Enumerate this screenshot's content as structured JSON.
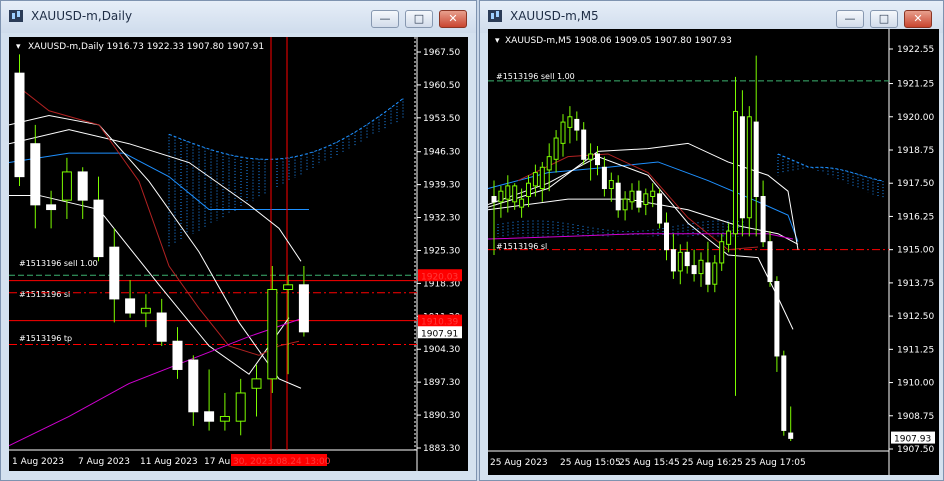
{
  "colors": {
    "background": "#000000",
    "bull_outline": "#7cfc00",
    "candle_body": "#ffffff",
    "ma_white": "#ffffff",
    "ma_red": "#b22222",
    "ma_magenta": "#d000d0",
    "ichimoku_blue": "#1e90ff",
    "order_line": "#ff0000",
    "order_green": "#3cb371"
  },
  "window_left": {
    "title": "XAUUSD-m,Daily",
    "ohlc_label": "XAUUSD-m,Daily 1916.73 1922.33 1907.80 1907.91",
    "orders": [
      "#1513196 sell 1.00",
      "#1513196 sl",
      "#1513196 tp"
    ],
    "axis_right": {
      "ticks": [
        "1967.50",
        "1960.50",
        "1953.50",
        "1946.30",
        "1939.30",
        "1932.30",
        "1925.30",
        "1918.30",
        "1911.30",
        "1904.30",
        "1897.30",
        "1890.30",
        "1883.30"
      ],
      "tags": [
        {
          "text": "1920.03",
          "bg": "#ff0000",
          "fg": "#ff3a3a"
        },
        {
          "text": "1910.39",
          "bg": "#ff0000",
          "fg": "#ff3a3a"
        },
        {
          "text": "1907.91",
          "bg": "#ffffff",
          "fg": "#000000"
        }
      ]
    },
    "axis_bottom": {
      "ticks": [
        "1 Aug 2023",
        "7 Aug 2023",
        "11 Aug 2023",
        "17 Au"
      ],
      "highlight": "30, 2023.08.24 13:00"
    }
  },
  "window_right": {
    "title": "XAUUSD-m,M5",
    "ohlc_label": "XAUUSD-m,M5 1908.06 1909.05 1907.80 1907.93",
    "orders": [
      "#1513196 sell 1.00",
      "#1513196 sl"
    ],
    "axis_right": {
      "ticks": [
        "1922.55",
        "1921.25",
        "1920.00",
        "1918.75",
        "1917.50",
        "1916.25",
        "1915.00",
        "1913.75",
        "1912.50",
        "1911.25",
        "1910.00",
        "1908.75",
        "1907.50"
      ],
      "price_tag": "1907.93"
    },
    "axis_bottom": {
      "ticks": [
        "25 Aug 2023",
        "25 Aug 15:05",
        "25 Aug 15:45",
        "25 Aug 16:25",
        "25 Aug 17:05"
      ]
    }
  },
  "chart_data": [
    {
      "type": "candlestick",
      "title": "XAUUSD-m,Daily",
      "x_labels": [
        "1 Aug 2023",
        "7 Aug 2023",
        "11 Aug 2023",
        "17 Au"
      ],
      "ylim": [
        1883.3,
        1967.5
      ],
      "candles": [
        {
          "o": 1963,
          "h": 1967,
          "l": 1939,
          "c": 1941
        },
        {
          "o": 1948,
          "h": 1952,
          "l": 1930,
          "c": 1935
        },
        {
          "o": 1935,
          "h": 1938,
          "l": 1930,
          "c": 1934
        },
        {
          "o": 1936,
          "h": 1945,
          "l": 1932,
          "c": 1942
        },
        {
          "o": 1942,
          "h": 1943,
          "l": 1932,
          "c": 1936
        },
        {
          "o": 1936,
          "h": 1941,
          "l": 1923,
          "c": 1924
        },
        {
          "o": 1926,
          "h": 1930,
          "l": 1910,
          "c": 1915
        },
        {
          "o": 1915,
          "h": 1919,
          "l": 1911,
          "c": 1912
        },
        {
          "o": 1912,
          "h": 1916,
          "l": 1909,
          "c": 1913
        },
        {
          "o": 1912,
          "h": 1915,
          "l": 1905,
          "c": 1906
        },
        {
          "o": 1906,
          "h": 1909,
          "l": 1898,
          "c": 1900
        },
        {
          "o": 1902,
          "h": 1903,
          "l": 1888,
          "c": 1891
        },
        {
          "o": 1891,
          "h": 1900,
          "l": 1887,
          "c": 1889
        },
        {
          "o": 1889,
          "h": 1895,
          "l": 1887,
          "c": 1890
        },
        {
          "o": 1889,
          "h": 1898,
          "l": 1886,
          "c": 1895
        },
        {
          "o": 1896,
          "h": 1901,
          "l": 1890,
          "c": 1898
        },
        {
          "o": 1898,
          "h": 1922,
          "l": 1895,
          "c": 1917
        },
        {
          "o": 1917,
          "h": 1920,
          "l": 1899,
          "c": 1918
        },
        {
          "o": 1918,
          "h": 1922,
          "l": 1907,
          "c": 1908
        }
      ]
    },
    {
      "type": "candlestick",
      "title": "XAUUSD-m,M5",
      "x_labels": [
        "25 Aug 2023",
        "25 Aug 15:05",
        "25 Aug 15:45",
        "25 Aug 16:25",
        "25 Aug 17:05"
      ],
      "ylim": [
        1907.5,
        1922.55
      ],
      "candles": [
        {
          "o": 1917.0,
          "h": 1917.6,
          "l": 1914.8,
          "c": 1916.8
        },
        {
          "o": 1916.8,
          "h": 1917.4,
          "l": 1916.2,
          "c": 1917.2
        },
        {
          "o": 1916.9,
          "h": 1917.8,
          "l": 1916.4,
          "c": 1917.4
        },
        {
          "o": 1916.8,
          "h": 1917.5,
          "l": 1916.5,
          "c": 1917.4
        },
        {
          "o": 1916.6,
          "h": 1917.3,
          "l": 1916.2,
          "c": 1916.9
        },
        {
          "o": 1917.0,
          "h": 1917.8,
          "l": 1916.6,
          "c": 1917.5
        },
        {
          "o": 1917.4,
          "h": 1918.2,
          "l": 1917.0,
          "c": 1917.9
        },
        {
          "o": 1917.3,
          "h": 1918.3,
          "l": 1916.8,
          "c": 1918.1
        },
        {
          "o": 1918.0,
          "h": 1919.0,
          "l": 1917.2,
          "c": 1918.5
        },
        {
          "o": 1918.4,
          "h": 1919.5,
          "l": 1917.9,
          "c": 1919.2
        },
        {
          "o": 1919.0,
          "h": 1920.1,
          "l": 1918.5,
          "c": 1919.8
        },
        {
          "o": 1919.6,
          "h": 1920.4,
          "l": 1919.0,
          "c": 1920.0
        },
        {
          "o": 1919.9,
          "h": 1920.2,
          "l": 1919.1,
          "c": 1919.5
        },
        {
          "o": 1919.5,
          "h": 1919.8,
          "l": 1918.2,
          "c": 1918.4
        },
        {
          "o": 1918.4,
          "h": 1919.0,
          "l": 1917.6,
          "c": 1918.6
        },
        {
          "o": 1918.6,
          "h": 1918.9,
          "l": 1917.8,
          "c": 1918.2
        },
        {
          "o": 1918.1,
          "h": 1918.5,
          "l": 1917.0,
          "c": 1917.3
        },
        {
          "o": 1917.3,
          "h": 1917.9,
          "l": 1916.8,
          "c": 1917.6
        },
        {
          "o": 1917.5,
          "h": 1917.8,
          "l": 1916.2,
          "c": 1916.5
        },
        {
          "o": 1916.5,
          "h": 1917.2,
          "l": 1916.1,
          "c": 1916.9
        },
        {
          "o": 1916.8,
          "h": 1917.5,
          "l": 1916.5,
          "c": 1917.2
        },
        {
          "o": 1917.2,
          "h": 1917.6,
          "l": 1916.4,
          "c": 1916.6
        },
        {
          "o": 1916.7,
          "h": 1917.3,
          "l": 1916.3,
          "c": 1917.1
        },
        {
          "o": 1917.0,
          "h": 1917.5,
          "l": 1916.6,
          "c": 1917.2
        },
        {
          "o": 1917.1,
          "h": 1917.3,
          "l": 1915.8,
          "c": 1916.0
        },
        {
          "o": 1916.0,
          "h": 1916.4,
          "l": 1914.6,
          "c": 1915.0
        },
        {
          "o": 1915.0,
          "h": 1915.6,
          "l": 1913.9,
          "c": 1914.2
        },
        {
          "o": 1914.2,
          "h": 1915.2,
          "l": 1913.7,
          "c": 1914.9
        },
        {
          "o": 1914.9,
          "h": 1915.3,
          "l": 1914.1,
          "c": 1914.4
        },
        {
          "o": 1914.4,
          "h": 1915.0,
          "l": 1913.8,
          "c": 1914.1
        },
        {
          "o": 1914.1,
          "h": 1914.9,
          "l": 1913.6,
          "c": 1914.6
        },
        {
          "o": 1914.5,
          "h": 1915.3,
          "l": 1913.4,
          "c": 1913.7
        },
        {
          "o": 1913.7,
          "h": 1914.8,
          "l": 1913.4,
          "c": 1914.5
        },
        {
          "o": 1914.5,
          "h": 1915.6,
          "l": 1914.2,
          "c": 1915.3
        },
        {
          "o": 1915.2,
          "h": 1916.0,
          "l": 1914.9,
          "c": 1915.7
        },
        {
          "o": 1915.6,
          "h": 1921.5,
          "l": 1909.5,
          "c": 1920.2
        },
        {
          "o": 1920.0,
          "h": 1921.0,
          "l": 1915.5,
          "c": 1916.2
        },
        {
          "o": 1916.2,
          "h": 1920.4,
          "l": 1915.5,
          "c": 1920.0
        },
        {
          "o": 1919.8,
          "h": 1922.3,
          "l": 1915.5,
          "c": 1917.0
        },
        {
          "o": 1917.0,
          "h": 1917.6,
          "l": 1915.1,
          "c": 1915.3
        },
        {
          "o": 1915.3,
          "h": 1915.7,
          "l": 1913.6,
          "c": 1913.8
        },
        {
          "o": 1913.8,
          "h": 1914.0,
          "l": 1910.4,
          "c": 1911.0
        },
        {
          "o": 1911.0,
          "h": 1911.2,
          "l": 1908.0,
          "c": 1908.2
        },
        {
          "o": 1908.1,
          "h": 1909.1,
          "l": 1907.8,
          "c": 1907.9
        }
      ]
    }
  ]
}
